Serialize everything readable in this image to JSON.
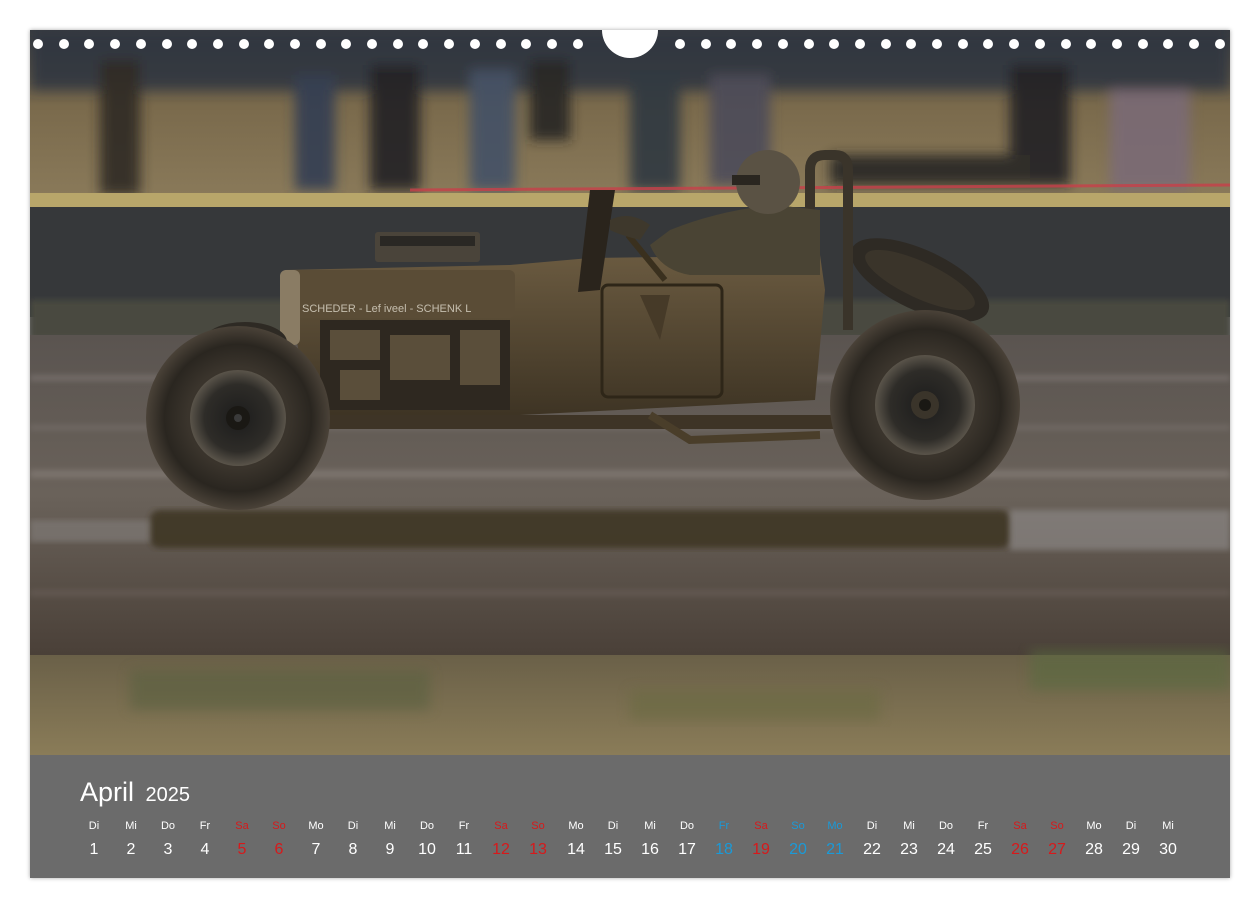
{
  "calendar": {
    "month": "April",
    "year": "2025",
    "days": [
      {
        "wd": "Di",
        "n": "1",
        "t": "w"
      },
      {
        "wd": "Mi",
        "n": "2",
        "t": "w"
      },
      {
        "wd": "Do",
        "n": "3",
        "t": "w"
      },
      {
        "wd": "Fr",
        "n": "4",
        "t": "w"
      },
      {
        "wd": "Sa",
        "n": "5",
        "t": "e"
      },
      {
        "wd": "So",
        "n": "6",
        "t": "e"
      },
      {
        "wd": "Mo",
        "n": "7",
        "t": "w"
      },
      {
        "wd": "Di",
        "n": "8",
        "t": "w"
      },
      {
        "wd": "Mi",
        "n": "9",
        "t": "w"
      },
      {
        "wd": "Do",
        "n": "10",
        "t": "w"
      },
      {
        "wd": "Fr",
        "n": "11",
        "t": "w"
      },
      {
        "wd": "Sa",
        "n": "12",
        "t": "e"
      },
      {
        "wd": "So",
        "n": "13",
        "t": "e"
      },
      {
        "wd": "Mo",
        "n": "14",
        "t": "w"
      },
      {
        "wd": "Di",
        "n": "15",
        "t": "w"
      },
      {
        "wd": "Mi",
        "n": "16",
        "t": "w"
      },
      {
        "wd": "Do",
        "n": "17",
        "t": "w"
      },
      {
        "wd": "Fr",
        "n": "18",
        "t": "h"
      },
      {
        "wd": "Sa",
        "n": "19",
        "t": "e"
      },
      {
        "wd": "So",
        "n": "20",
        "t": "h"
      },
      {
        "wd": "Mo",
        "n": "21",
        "t": "h"
      },
      {
        "wd": "Di",
        "n": "22",
        "t": "w"
      },
      {
        "wd": "Mi",
        "n": "23",
        "t": "w"
      },
      {
        "wd": "Do",
        "n": "24",
        "t": "w"
      },
      {
        "wd": "Fr",
        "n": "25",
        "t": "w"
      },
      {
        "wd": "Sa",
        "n": "26",
        "t": "e"
      },
      {
        "wd": "So",
        "n": "27",
        "t": "e"
      },
      {
        "wd": "Mo",
        "n": "28",
        "t": "w"
      },
      {
        "wd": "Di",
        "n": "29",
        "t": "w"
      },
      {
        "wd": "Mi",
        "n": "30",
        "t": "w"
      }
    ]
  },
  "photo": {
    "car_lettering": "SCHEDER - Lef iveel - SCHENK L"
  },
  "colors": {
    "weekday": "#ffffff",
    "weekend": "#d7191b",
    "holiday": "#1a9ad8",
    "calendar_band": "#6b6b6b"
  }
}
